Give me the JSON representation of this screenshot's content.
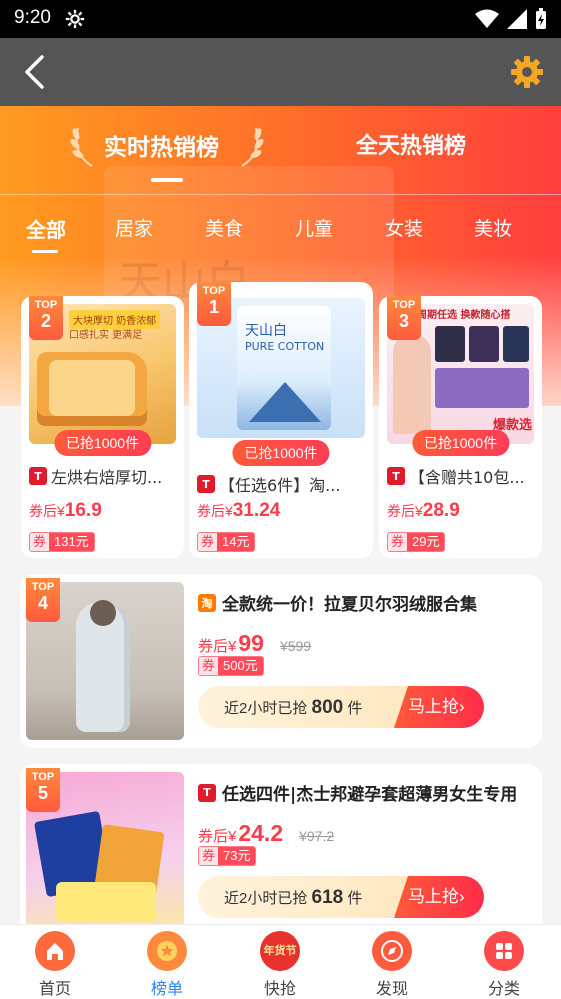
{
  "status": {
    "time": "9:20"
  },
  "rank_tabs": [
    {
      "label": "实时热销榜"
    },
    {
      "label": "全天热销榜"
    }
  ],
  "categories": [
    "全部",
    "居家",
    "美食",
    "儿童",
    "女装",
    "美妆"
  ],
  "top3": [
    {
      "rank": "2",
      "top": "TOP",
      "sold": "已抢1000件",
      "title": "左烘右焙厚切...",
      "price_pre": "券后¥",
      "price": "16.9",
      "coupon_q": "券",
      "coupon": "131元",
      "shop_icon": "T",
      "img_text": "大块厚切 奶香浓郁",
      "img_sub": "口感扎实 更满足"
    },
    {
      "rank": "1",
      "top": "TOP",
      "sold": "已抢1000件",
      "title": "【任选6件】淘...",
      "price_pre": "券后¥",
      "price": "31.24",
      "coupon_q": "券",
      "coupon": "14元",
      "shop_icon": "T",
      "img_text": "天山白",
      "img_sub": "PURE COTTON"
    },
    {
      "rank": "3",
      "top": "TOP",
      "sold": "已抢1000件",
      "title": "【含赠共10包...",
      "price_pre": "券后¥",
      "price": "28.9",
      "coupon_q": "券",
      "coupon": "29元",
      "shop_icon": "T",
      "img_text": "周期任选 换款随心搭",
      "img_sub": "爆款选"
    }
  ],
  "items": [
    {
      "rank": "4",
      "top": "TOP",
      "shop_icon": "淘",
      "title": "全款统一价！拉夏贝尔羽绒服合集",
      "price_pre": "券后¥",
      "price": "99",
      "orig": "¥599",
      "coupon_q": "券",
      "coupon": "500元",
      "grab_pre": "近2小时已抢",
      "grab_count": "800",
      "grab_unit": "件",
      "grab_btn": "马上抢"
    },
    {
      "rank": "5",
      "top": "TOP",
      "shop_icon": "T",
      "title": "任选四件|杰士邦避孕套超薄男女生专用",
      "price_pre": "券后¥",
      "price": "24.2",
      "orig": "¥97.2",
      "coupon_q": "券",
      "coupon": "73元",
      "grab_pre": "近2小时已抢",
      "grab_count": "618",
      "grab_unit": "件",
      "grab_btn": "马上抢"
    }
  ],
  "tabbar": [
    {
      "label": "首页",
      "icon": "home-icon"
    },
    {
      "label": "榜单",
      "icon": "ranking-icon"
    },
    {
      "label": "快抢",
      "icon": "new-year-festival-icon",
      "icon_text": "年货节"
    },
    {
      "label": "发现",
      "icon": "compass-icon"
    },
    {
      "label": "分类",
      "icon": "category-icon"
    }
  ],
  "colors": {
    "accent": "#ff3b4c",
    "hero_left": "#ff9b1f",
    "hero_right": "#ff3f3f",
    "active_tab": "#2d7ff0"
  }
}
